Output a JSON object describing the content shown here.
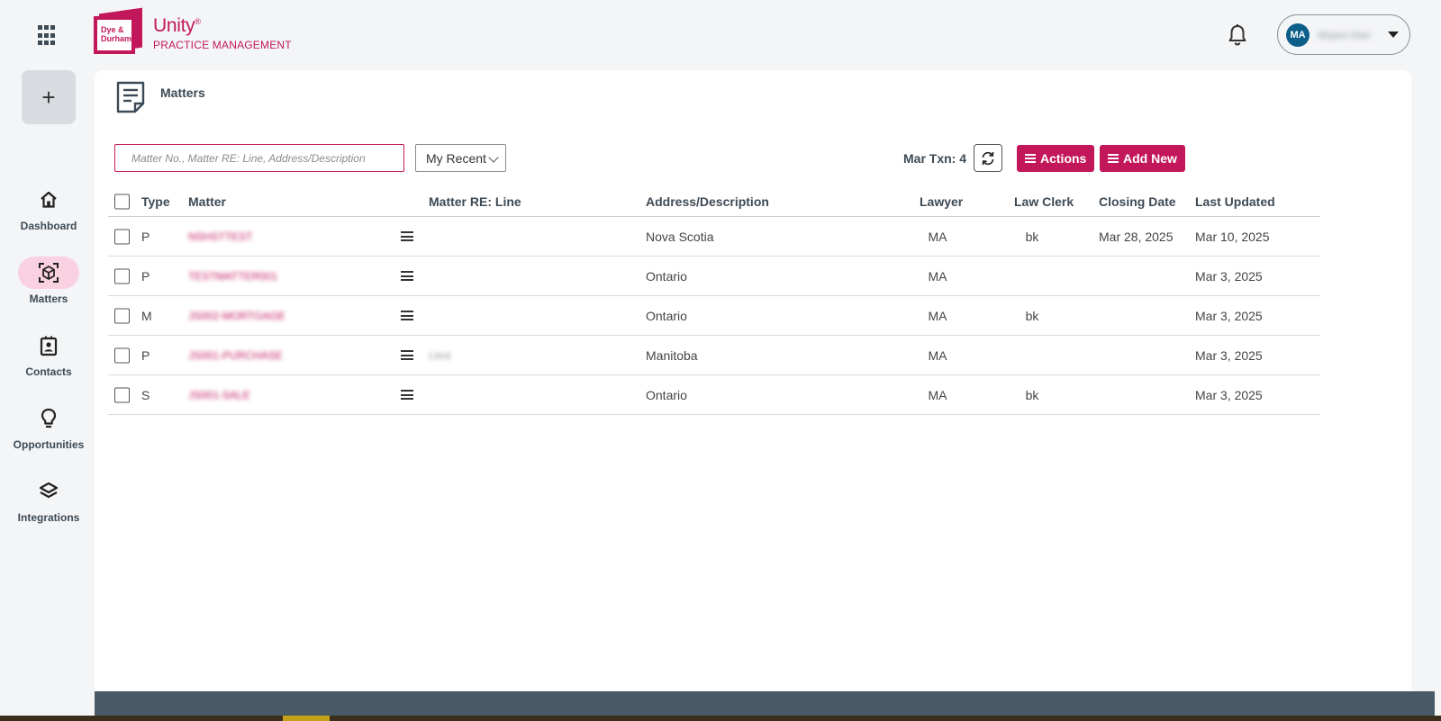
{
  "brand": {
    "logo_text": "Dye & Durham",
    "product": "Unity",
    "product_mark": "®",
    "subtitle": "PRACTICE MANAGEMENT"
  },
  "user": {
    "initials": "MA",
    "name": "Majed Atwi"
  },
  "sidebar": {
    "add_label": "+",
    "items": [
      {
        "label": "Dashboard",
        "icon": "home-icon",
        "active": false
      },
      {
        "label": "Matters",
        "icon": "cube-icon",
        "active": true
      },
      {
        "label": "Contacts",
        "icon": "contact-card-icon",
        "active": false
      },
      {
        "label": "Opportunities",
        "icon": "lightbulb-icon",
        "active": false
      },
      {
        "label": "Integrations",
        "icon": "layers-icon",
        "active": false
      }
    ]
  },
  "page": {
    "title": "Matters"
  },
  "toolbar": {
    "search_placeholder": "Matter No., Matter RE: Line, Address/Description",
    "filter_value": "My Recent",
    "txn_label": "Mar Txn: 4",
    "actions_label": "Actions",
    "add_new_label": "Add New"
  },
  "table": {
    "columns": {
      "type": "Type",
      "matter": "Matter",
      "re_line": "Matter RE: Line",
      "address": "Address/Description",
      "lawyer": "Lawyer",
      "clerk": "Law Clerk",
      "closing": "Closing Date",
      "updated": "Last Updated"
    },
    "rows": [
      {
        "type": "P",
        "matter": "NSHSTTEST",
        "re_line": "",
        "address": "Nova Scotia",
        "lawyer": "MA",
        "clerk": "bk",
        "closing": "Mar 28, 2025",
        "updated": "Mar 10, 2025"
      },
      {
        "type": "P",
        "matter": "TESTMATTER001",
        "re_line": "",
        "address": "Ontario",
        "lawyer": "MA",
        "clerk": "",
        "closing": "",
        "updated": "Mar 3, 2025"
      },
      {
        "type": "M",
        "matter": "JS002-MORTGAGE",
        "re_line": "",
        "address": "Ontario",
        "lawyer": "MA",
        "clerk": "bk",
        "closing": "",
        "updated": "Mar 3, 2025"
      },
      {
        "type": "P",
        "matter": "JS001-PURCHASE",
        "re_line": "Lbrd",
        "address": "Manitoba",
        "lawyer": "MA",
        "clerk": "",
        "closing": "",
        "updated": "Mar 3, 2025"
      },
      {
        "type": "S",
        "matter": "JS001-SALE",
        "re_line": "",
        "address": "Ontario",
        "lawyer": "MA",
        "clerk": "bk",
        "closing": "",
        "updated": "Mar 3, 2025"
      }
    ]
  },
  "colors": {
    "brand": "#c2185b",
    "avatar": "#0d5f8a",
    "footer": "#495a66"
  }
}
